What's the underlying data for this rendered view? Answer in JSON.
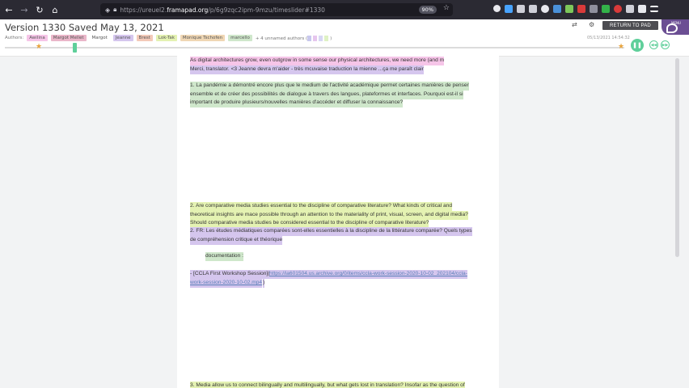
{
  "browser": {
    "url_prefix": "https://ureuel2.",
    "url_domain": "framapad.org",
    "url_suffix": "/p/6g9zqc2ipm-9mzu/timeslider#1330",
    "zoom": "90%",
    "nav_icons": [
      "back-icon",
      "forward-icon",
      "reload-icon",
      "home-icon"
    ]
  },
  "header": {
    "title": "Version 1330 Saved May 13, 2021",
    "authors_label": "Authors:",
    "authors": [
      {
        "name": "Awilina",
        "color": "#f6c5e8"
      },
      {
        "name": "Margot Mellet",
        "color": "#eab6c9"
      },
      {
        "name": "Margot",
        "color": "#ffffff"
      },
      {
        "name": "Jeanne",
        "color": "#d5c6ee"
      },
      {
        "name": "Brest",
        "color": "#f3c9b8"
      },
      {
        "name": "Lok-Tak",
        "color": "#e4f2b2"
      },
      {
        "name": "Monique Tschofen",
        "color": "#f0d7b4"
      },
      {
        "name": "marcello",
        "color": "#cfe7cb"
      }
    ],
    "unnamed_authors": "+ 4 unnamed authors (",
    "unnamed_close": ")",
    "unnamed_colors": [
      "#c8c8ee",
      "#e6c6ee",
      "#d8d8f4",
      "#dff2c4"
    ],
    "timestamp": "05/13/2021 14:54:32",
    "return_button": "RETURN TO PAD",
    "menu_label": "MENU",
    "accent": "#5fcf9a"
  },
  "timeslider": {
    "position_fraction": 0.11
  },
  "document": {
    "lines": [
      {
        "text": "As digital architectures grow, even outgrow in some sense our physical architectures, we need more (and m",
        "color": "pink"
      },
      {
        "text": "Merci, translator. <3 Jeanne devra m'aider - très mcuvaise traduction la mienne ...ça me paraît clair",
        "color": "purple"
      },
      {
        "text": "1. La pandémie a démontré encore plus que le medium de l'activité académique permet certaines manières de penser",
        "color": "green"
      },
      {
        "text": "ensemble et de créer des possibilités de dialogue à travers des langues, plateformes et interfaces. Pourquoi est-il si",
        "color": "green"
      },
      {
        "text": "important de produire plusieurs/nouvelles manières d'accéder et diffuser la connaissance?",
        "color": "green"
      },
      {
        "text": "2.  Are comparative media studies essential to the discipline of comparative literature? What kinds of critical and",
        "color": "yellow"
      },
      {
        "text": "theoretical insights are mace possible through an attention to the materiality of print, visual, screen, and digital media?",
        "color": "yellow"
      },
      {
        "text": "Should comparative media studies be considered essential to the discipline of comparative literature?",
        "color": "yellow"
      },
      {
        "text": "2. FR: Les études médiatiques comparées sont-elles essentielles à la discipline de la littérature comparée? Quels types",
        "color": "purple"
      },
      {
        "text": "de compréhension critique et théorique",
        "color": "purple"
      },
      {
        "text": "documentation :",
        "color": "green"
      },
      {
        "text": "- [CCLA First Workshop Session](",
        "color": "purple"
      },
      {
        "text": "https://ia601504.us.archive.org/0/items/ccla-work-session-2020-10-02_202104/ccla-",
        "color": "purple"
      },
      {
        "text": "work-session-2020-10-02.mp4",
        "color": "purple"
      },
      {
        "text": ")",
        "color": "purple"
      },
      {
        "text": "3. Media allow us to connect bilingually and multilingually, but what gets lost in translation? Insofar as the question of",
        "color": "yellow"
      }
    ]
  }
}
